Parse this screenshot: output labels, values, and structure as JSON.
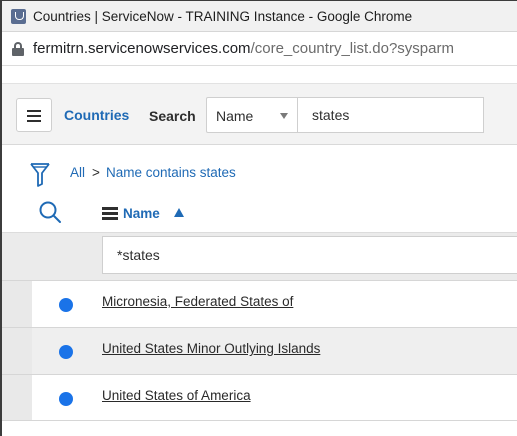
{
  "window": {
    "title": "Countries | ServiceNow - TRAINING Instance - Google Chrome"
  },
  "address_bar": {
    "host": "fermitrn.servicenowservices.com",
    "path": "/core_country_list.do?sysparm"
  },
  "list_header": {
    "title": "Countries",
    "search_label": "Search",
    "search_field_selected": "Name",
    "search_value": "states"
  },
  "breadcrumb": {
    "all_label": "All",
    "separator": ">",
    "condition_label": "Name contains states"
  },
  "column_header": {
    "name_label": "Name",
    "sort_direction": "ascending"
  },
  "filter_row": {
    "value": "*states"
  },
  "rows": [
    {
      "name": "Micronesia, Federated States of"
    },
    {
      "name": "United States Minor Outlying Islands"
    },
    {
      "name": "United States of America"
    }
  ],
  "colors": {
    "link_blue": "#1f6ab5",
    "status_dot": "#1a73e8",
    "header_bg": "#f3f3f3"
  },
  "icons": {
    "app": "servicenow-logo-icon",
    "lock": "lock-icon",
    "menu": "hamburger-menu-icon",
    "filter": "funnel-filter-icon",
    "search": "magnifier-search-icon",
    "column_menu": "column-menu-icon",
    "sort": "sort-ascending-icon"
  }
}
